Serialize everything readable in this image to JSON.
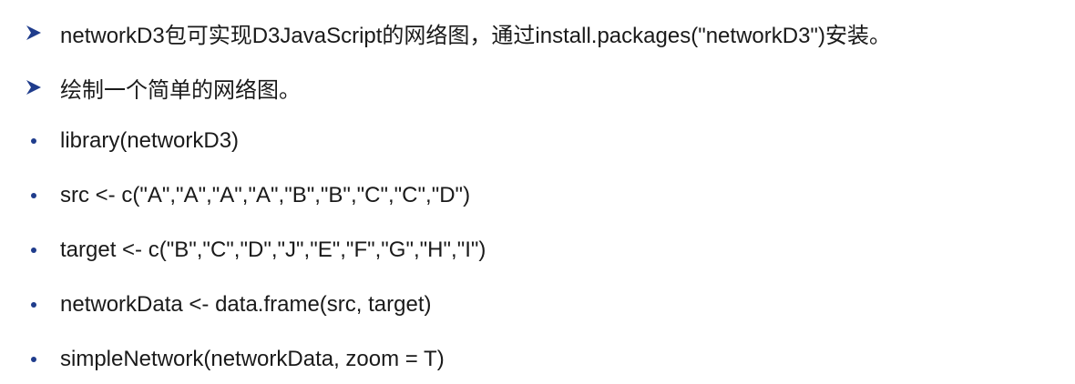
{
  "colors": {
    "bullet": "#1f3c8c",
    "text": "#1a1a1a"
  },
  "items": [
    {
      "bullet": "arrow",
      "text": "networkD3包可实现D3JavaScript的网络图，通过install.packages(\"networkD3\")安装。"
    },
    {
      "bullet": "arrow",
      "text": "绘制一个简单的网络图。"
    },
    {
      "bullet": "dot",
      "text": "library(networkD3)"
    },
    {
      "bullet": "dot",
      "text": "src <- c(\"A\",\"A\",\"A\",\"A\",\"B\",\"B\",\"C\",\"C\",\"D\")"
    },
    {
      "bullet": "dot",
      "text": "target <- c(\"B\",\"C\",\"D\",\"J\",\"E\",\"F\",\"G\",\"H\",\"I\")"
    },
    {
      "bullet": "dot",
      "text": "networkData <- data.frame(src, target)"
    },
    {
      "bullet": "dot",
      "text": "simpleNetwork(networkData, zoom = T)"
    }
  ]
}
